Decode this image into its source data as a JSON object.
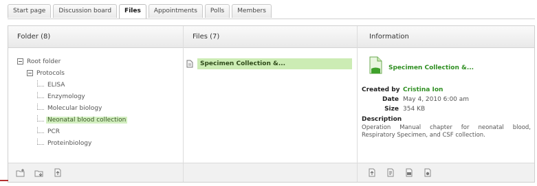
{
  "tabs": [
    {
      "label": "Start page",
      "active": false
    },
    {
      "label": "Discussion board",
      "active": false
    },
    {
      "label": "Files",
      "active": true
    },
    {
      "label": "Appointments",
      "active": false
    },
    {
      "label": "Polls",
      "active": false
    },
    {
      "label": "Members",
      "active": false
    }
  ],
  "folders": {
    "header": "Folder (8)",
    "root": "Root folder",
    "group": "Protocols",
    "items": [
      "ELISA",
      "Enzymology",
      "Molecular biology",
      "Neonatal blood collection",
      "PCR",
      "Proteinbiology"
    ],
    "selected": "Neonatal blood collection",
    "footer_icons": [
      "add-folder-icon",
      "move-folder-icon",
      "upload-icon"
    ]
  },
  "files": {
    "header": "Files (7)",
    "items": [
      {
        "name": "Specimen Collection &...",
        "icon": "document-icon",
        "selected": true
      }
    ]
  },
  "information": {
    "header": "Information",
    "title": "Specimen Collection &...",
    "created_by_label": "Created by",
    "created_by": "Cristina Ion",
    "date_label": "Date",
    "date": "May 4, 2010 6:00 am",
    "size_label": "Size",
    "size": "354 KB",
    "description_label": "Description",
    "description": "Operation Manual chapter for neonatal blood, Respiratory Specimen, and CSF collection.",
    "footer_icons": [
      "upload-file-icon",
      "edit-file-icon",
      "download-icon",
      "delete-icon"
    ]
  },
  "colors": {
    "accent": "#2f8f22",
    "selection": "#ccecb4",
    "border": "#cfcfcf"
  }
}
